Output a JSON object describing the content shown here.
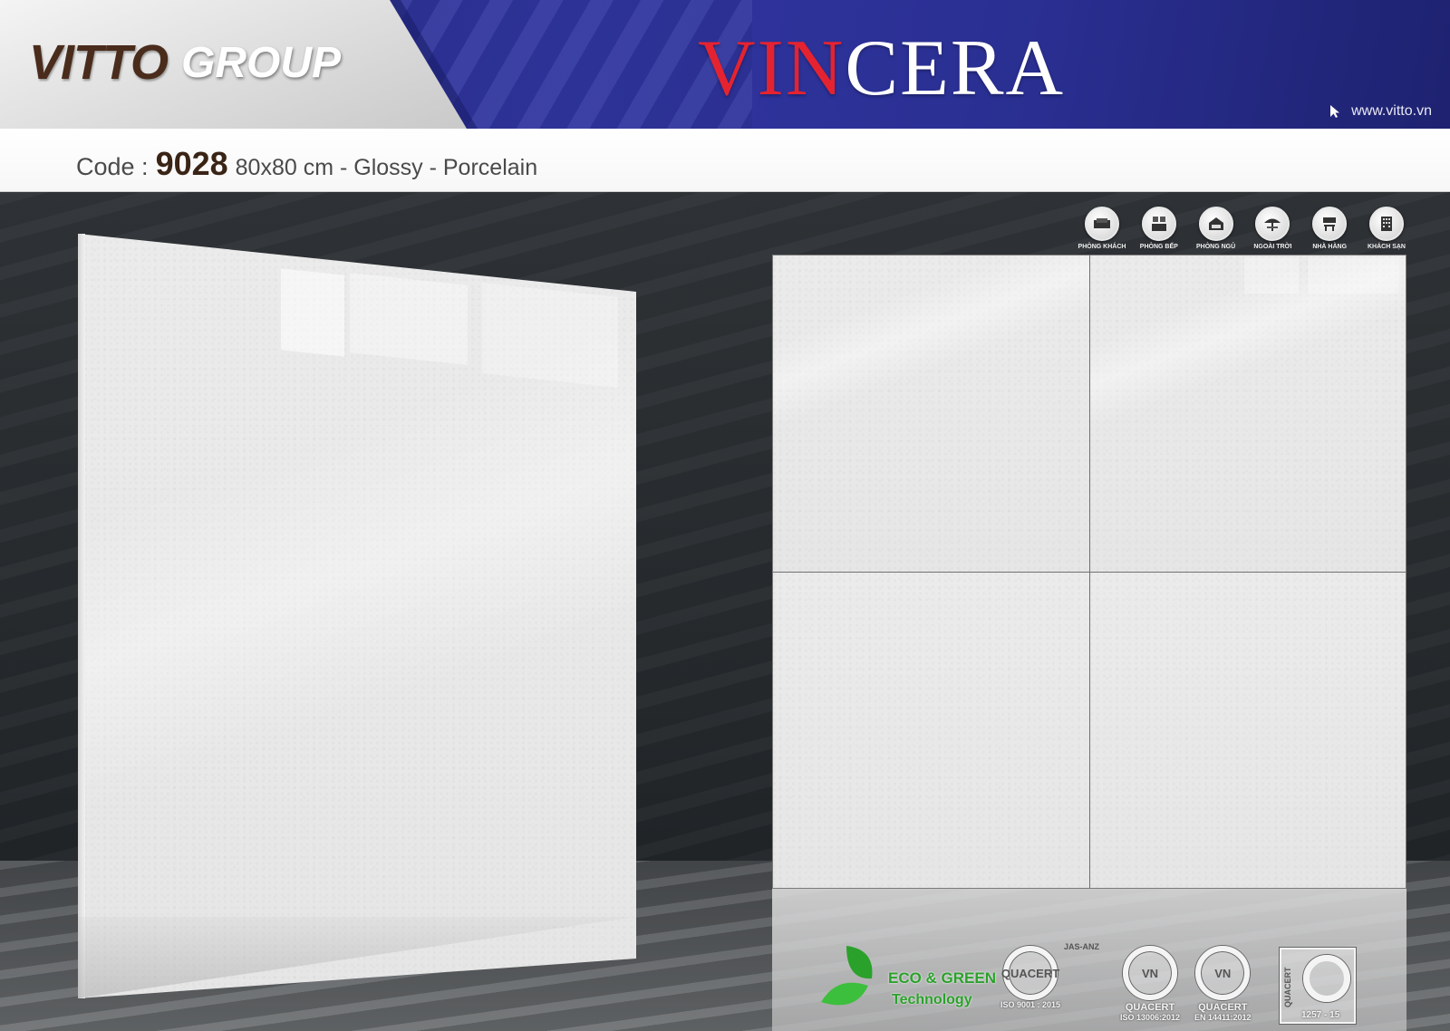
{
  "header": {
    "logo_vitto": "VITTO",
    "logo_group": "GROUP",
    "brand_red": "VIN",
    "brand_white": "CERA",
    "website": "www.vitto.vn",
    "accent_red": "#e52330",
    "header_blue": "#2a2e8a"
  },
  "product": {
    "code_label": "Code :",
    "code_number": "9028",
    "description": "80x80 cm - Glossy - Porcelain"
  },
  "room_icons": [
    {
      "label": "PHÒNG KHÁCH",
      "icon": "sofa-icon"
    },
    {
      "label": "PHÒNG BẾP",
      "icon": "kitchen-icon"
    },
    {
      "label": "PHÒNG NGỦ",
      "icon": "bed-icon"
    },
    {
      "label": "NGOÀI TRỜI",
      "icon": "umbrella-icon"
    },
    {
      "label": "NHÀ HÀNG",
      "icon": "restaurant-icon"
    },
    {
      "label": "KHÁCH SẠN",
      "icon": "hotel-icon"
    }
  ],
  "certifications": {
    "eco_line1": "ECO & GREEN",
    "eco_line2": "Technology",
    "jas_anz": "JAS-ANZ",
    "cert1_name": "QUACERT",
    "cert1_std": "ISO 9001 : 2015",
    "cert2_name": "QUACERT",
    "cert2_std": "ISO 13006:2012",
    "cert3_name": "QUACERT",
    "cert3_std": "EN 14411:2012",
    "cert4_name": "QUACERT",
    "cert4_std": "1257 - 15",
    "eco_color": "#2aa12a"
  }
}
